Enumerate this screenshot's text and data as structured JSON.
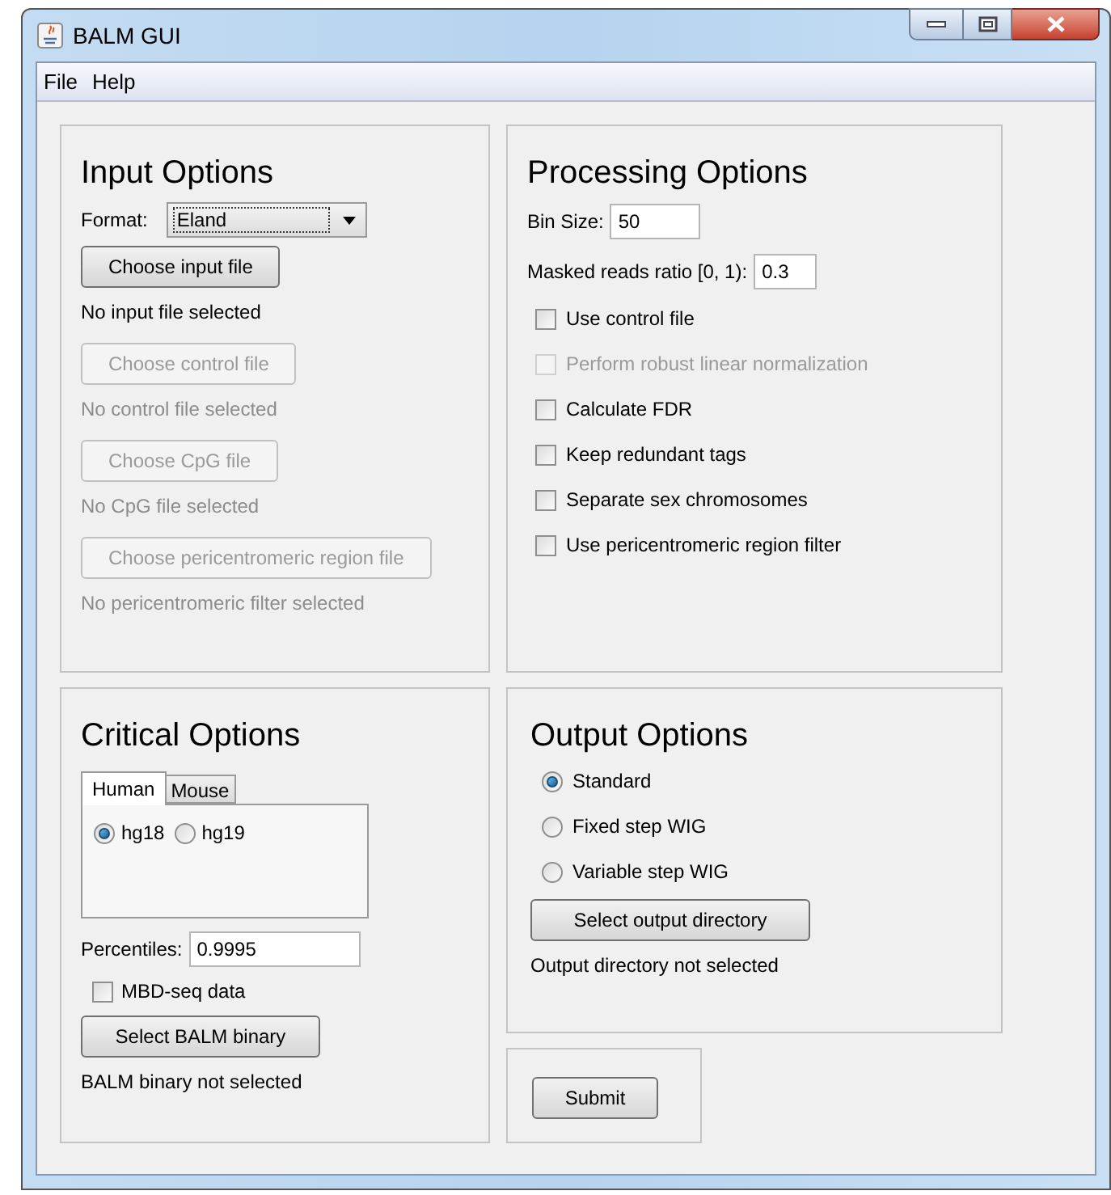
{
  "window": {
    "title": "BALM GUI"
  },
  "menu": [
    "File",
    "Help"
  ],
  "input_options": {
    "title": "Input Options",
    "format_label": "Format:",
    "format_value": "Eland",
    "items": [
      {
        "kind": "button",
        "label": "Choose input file",
        "disabled": false
      },
      {
        "kind": "status",
        "text": "No input file selected",
        "disabled": false
      },
      {
        "kind": "button",
        "label": "Choose control file",
        "disabled": true
      },
      {
        "kind": "status",
        "text": "No control file selected",
        "disabled": true
      },
      {
        "kind": "button",
        "label": "Choose CpG file",
        "disabled": true
      },
      {
        "kind": "status",
        "text": "No CpG file selected",
        "disabled": true
      },
      {
        "kind": "button",
        "label": "Choose pericentromeric region file",
        "disabled": true
      },
      {
        "kind": "status",
        "text": "No pericentromeric filter selected",
        "disabled": true
      }
    ]
  },
  "processing_options": {
    "title": "Processing Options",
    "bin_size": {
      "label": "Bin Size:",
      "value": "50"
    },
    "masked_ratio": {
      "label": "Masked reads ratio [0, 1):",
      "value": "0.3"
    },
    "checkboxes": [
      {
        "label": "Use control file",
        "checked": false,
        "disabled": false
      },
      {
        "label": "Perform robust linear normalization",
        "checked": false,
        "disabled": true
      },
      {
        "label": "Calculate FDR",
        "checked": false,
        "disabled": false
      },
      {
        "label": "Keep redundant tags",
        "checked": false,
        "disabled": false
      },
      {
        "label": "Separate sex chromosomes",
        "checked": false,
        "disabled": false
      },
      {
        "label": "Use pericentromeric region filter",
        "checked": false,
        "disabled": false
      }
    ]
  },
  "critical_options": {
    "title": "Critical Options",
    "tabs": [
      {
        "label": "Human",
        "selected": true
      },
      {
        "label": "Mouse",
        "selected": false
      }
    ],
    "radios": [
      {
        "label": "hg18",
        "selected": true
      },
      {
        "label": "hg19",
        "selected": false
      }
    ],
    "percentiles": {
      "label": "Percentiles:",
      "value": "0.9995"
    },
    "mbd_checkbox": {
      "label": "MBD-seq data",
      "checked": false
    },
    "button": "Select BALM binary",
    "status": "BALM binary not selected"
  },
  "output_options": {
    "title": "Output Options",
    "radios": [
      {
        "label": "Standard",
        "selected": true
      },
      {
        "label": "Fixed step WIG",
        "selected": false
      },
      {
        "label": "Variable step WIG",
        "selected": false
      }
    ],
    "button": "Select output directory",
    "status": "Output directory not selected"
  },
  "submit": "Submit"
}
